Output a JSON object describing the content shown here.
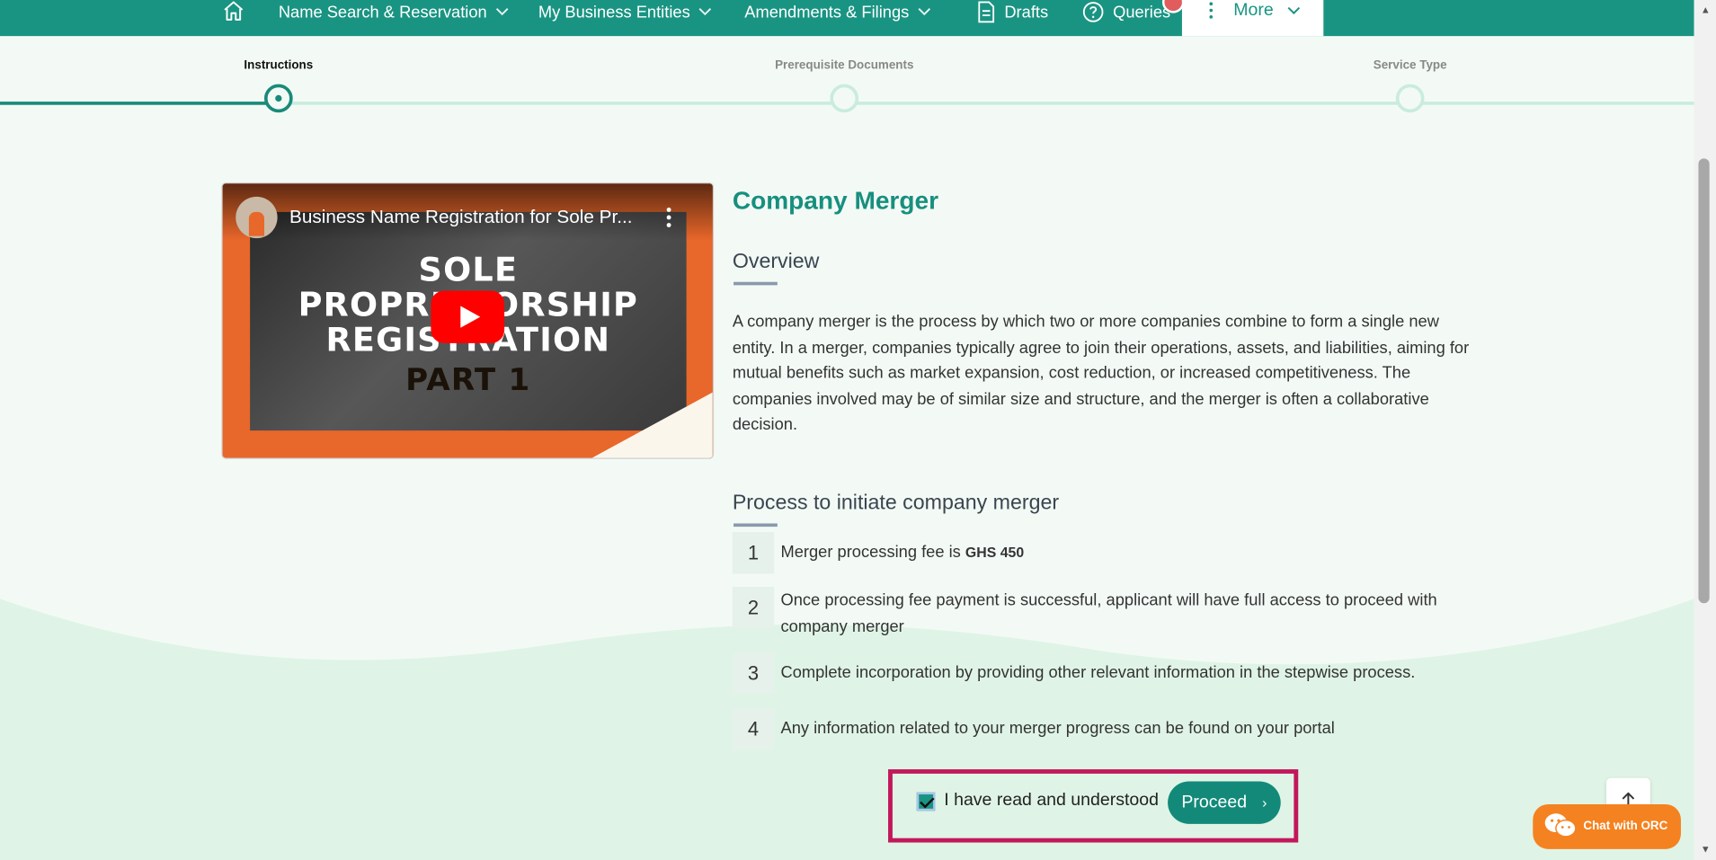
{
  "nav": {
    "items": [
      {
        "label": "Name Search & Reservation",
        "has_chevron": true
      },
      {
        "label": "My Business Entities",
        "has_chevron": true
      },
      {
        "label": "Amendments & Filings",
        "has_chevron": true
      },
      {
        "label": "Drafts",
        "icon": "document-icon"
      },
      {
        "label": "Queries",
        "icon": "question-circle-icon"
      }
    ],
    "more_label": "More",
    "accent": "#1a9482"
  },
  "stepper": {
    "steps": [
      {
        "label": "Instructions",
        "state": "active"
      },
      {
        "label": "Prerequisite Documents",
        "state": "pending"
      },
      {
        "label": "Service Type",
        "state": "pending"
      }
    ]
  },
  "video": {
    "title": "Business Name Registration for Sole Pr...",
    "poster_lines": [
      "SOLE",
      "PROPRIETORSHIP",
      "REGISTRATION",
      "PART 1"
    ]
  },
  "content": {
    "title": "Company Merger",
    "overview_heading": "Overview",
    "overview_text": "A company merger is the process by which two or more companies combine to form a single new entity. In a merger, companies typically agree to join their operations, assets, and liabilities, aiming for mutual benefits such as market expansion, cost reduction, or increased competitiveness. The companies involved may be of similar size and structure, and the merger is often a collaborative decision.",
    "process_heading": "Process to initiate company merger",
    "steps": [
      {
        "num": "1",
        "text": "Merger processing fee is ",
        "fee": "GHS 450"
      },
      {
        "num": "2",
        "text": "Once processing fee payment is successful, applicant will have full access to proceed with company merger"
      },
      {
        "num": "3",
        "text": "Complete incorporation by providing other relevant information in the stepwise process."
      },
      {
        "num": "4",
        "text": "Any information related to your merger progress can be found on your portal"
      }
    ]
  },
  "agree": {
    "checkbox_label": "I have read and understood",
    "checked": true,
    "proceed_label": "Proceed",
    "proceed_chevron": "›"
  },
  "floating": {
    "chat_label": "Chat with ORC",
    "scroll_top_icon": "arrow-up-icon"
  }
}
